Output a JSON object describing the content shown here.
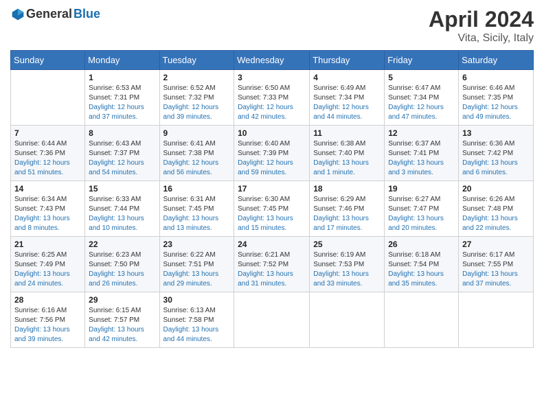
{
  "header": {
    "logo_general": "General",
    "logo_blue": "Blue",
    "month": "April 2024",
    "location": "Vita, Sicily, Italy"
  },
  "weekdays": [
    "Sunday",
    "Monday",
    "Tuesday",
    "Wednesday",
    "Thursday",
    "Friday",
    "Saturday"
  ],
  "weeks": [
    [
      {
        "day": "",
        "sunrise": "",
        "sunset": "",
        "daylight": ""
      },
      {
        "day": "1",
        "sunrise": "Sunrise: 6:53 AM",
        "sunset": "Sunset: 7:31 PM",
        "daylight": "Daylight: 12 hours and 37 minutes."
      },
      {
        "day": "2",
        "sunrise": "Sunrise: 6:52 AM",
        "sunset": "Sunset: 7:32 PM",
        "daylight": "Daylight: 12 hours and 39 minutes."
      },
      {
        "day": "3",
        "sunrise": "Sunrise: 6:50 AM",
        "sunset": "Sunset: 7:33 PM",
        "daylight": "Daylight: 12 hours and 42 minutes."
      },
      {
        "day": "4",
        "sunrise": "Sunrise: 6:49 AM",
        "sunset": "Sunset: 7:34 PM",
        "daylight": "Daylight: 12 hours and 44 minutes."
      },
      {
        "day": "5",
        "sunrise": "Sunrise: 6:47 AM",
        "sunset": "Sunset: 7:34 PM",
        "daylight": "Daylight: 12 hours and 47 minutes."
      },
      {
        "day": "6",
        "sunrise": "Sunrise: 6:46 AM",
        "sunset": "Sunset: 7:35 PM",
        "daylight": "Daylight: 12 hours and 49 minutes."
      }
    ],
    [
      {
        "day": "7",
        "sunrise": "Sunrise: 6:44 AM",
        "sunset": "Sunset: 7:36 PM",
        "daylight": "Daylight: 12 hours and 51 minutes."
      },
      {
        "day": "8",
        "sunrise": "Sunrise: 6:43 AM",
        "sunset": "Sunset: 7:37 PM",
        "daylight": "Daylight: 12 hours and 54 minutes."
      },
      {
        "day": "9",
        "sunrise": "Sunrise: 6:41 AM",
        "sunset": "Sunset: 7:38 PM",
        "daylight": "Daylight: 12 hours and 56 minutes."
      },
      {
        "day": "10",
        "sunrise": "Sunrise: 6:40 AM",
        "sunset": "Sunset: 7:39 PM",
        "daylight": "Daylight: 12 hours and 59 minutes."
      },
      {
        "day": "11",
        "sunrise": "Sunrise: 6:38 AM",
        "sunset": "Sunset: 7:40 PM",
        "daylight": "Daylight: 13 hours and 1 minute."
      },
      {
        "day": "12",
        "sunrise": "Sunrise: 6:37 AM",
        "sunset": "Sunset: 7:41 PM",
        "daylight": "Daylight: 13 hours and 3 minutes."
      },
      {
        "day": "13",
        "sunrise": "Sunrise: 6:36 AM",
        "sunset": "Sunset: 7:42 PM",
        "daylight": "Daylight: 13 hours and 6 minutes."
      }
    ],
    [
      {
        "day": "14",
        "sunrise": "Sunrise: 6:34 AM",
        "sunset": "Sunset: 7:43 PM",
        "daylight": "Daylight: 13 hours and 8 minutes."
      },
      {
        "day": "15",
        "sunrise": "Sunrise: 6:33 AM",
        "sunset": "Sunset: 7:44 PM",
        "daylight": "Daylight: 13 hours and 10 minutes."
      },
      {
        "day": "16",
        "sunrise": "Sunrise: 6:31 AM",
        "sunset": "Sunset: 7:45 PM",
        "daylight": "Daylight: 13 hours and 13 minutes."
      },
      {
        "day": "17",
        "sunrise": "Sunrise: 6:30 AM",
        "sunset": "Sunset: 7:45 PM",
        "daylight": "Daylight: 13 hours and 15 minutes."
      },
      {
        "day": "18",
        "sunrise": "Sunrise: 6:29 AM",
        "sunset": "Sunset: 7:46 PM",
        "daylight": "Daylight: 13 hours and 17 minutes."
      },
      {
        "day": "19",
        "sunrise": "Sunrise: 6:27 AM",
        "sunset": "Sunset: 7:47 PM",
        "daylight": "Daylight: 13 hours and 20 minutes."
      },
      {
        "day": "20",
        "sunrise": "Sunrise: 6:26 AM",
        "sunset": "Sunset: 7:48 PM",
        "daylight": "Daylight: 13 hours and 22 minutes."
      }
    ],
    [
      {
        "day": "21",
        "sunrise": "Sunrise: 6:25 AM",
        "sunset": "Sunset: 7:49 PM",
        "daylight": "Daylight: 13 hours and 24 minutes."
      },
      {
        "day": "22",
        "sunrise": "Sunrise: 6:23 AM",
        "sunset": "Sunset: 7:50 PM",
        "daylight": "Daylight: 13 hours and 26 minutes."
      },
      {
        "day": "23",
        "sunrise": "Sunrise: 6:22 AM",
        "sunset": "Sunset: 7:51 PM",
        "daylight": "Daylight: 13 hours and 29 minutes."
      },
      {
        "day": "24",
        "sunrise": "Sunrise: 6:21 AM",
        "sunset": "Sunset: 7:52 PM",
        "daylight": "Daylight: 13 hours and 31 minutes."
      },
      {
        "day": "25",
        "sunrise": "Sunrise: 6:19 AM",
        "sunset": "Sunset: 7:53 PM",
        "daylight": "Daylight: 13 hours and 33 minutes."
      },
      {
        "day": "26",
        "sunrise": "Sunrise: 6:18 AM",
        "sunset": "Sunset: 7:54 PM",
        "daylight": "Daylight: 13 hours and 35 minutes."
      },
      {
        "day": "27",
        "sunrise": "Sunrise: 6:17 AM",
        "sunset": "Sunset: 7:55 PM",
        "daylight": "Daylight: 13 hours and 37 minutes."
      }
    ],
    [
      {
        "day": "28",
        "sunrise": "Sunrise: 6:16 AM",
        "sunset": "Sunset: 7:56 PM",
        "daylight": "Daylight: 13 hours and 39 minutes."
      },
      {
        "day": "29",
        "sunrise": "Sunrise: 6:15 AM",
        "sunset": "Sunset: 7:57 PM",
        "daylight": "Daylight: 13 hours and 42 minutes."
      },
      {
        "day": "30",
        "sunrise": "Sunrise: 6:13 AM",
        "sunset": "Sunset: 7:58 PM",
        "daylight": "Daylight: 13 hours and 44 minutes."
      },
      {
        "day": "",
        "sunrise": "",
        "sunset": "",
        "daylight": ""
      },
      {
        "day": "",
        "sunrise": "",
        "sunset": "",
        "daylight": ""
      },
      {
        "day": "",
        "sunrise": "",
        "sunset": "",
        "daylight": ""
      },
      {
        "day": "",
        "sunrise": "",
        "sunset": "",
        "daylight": ""
      }
    ]
  ]
}
